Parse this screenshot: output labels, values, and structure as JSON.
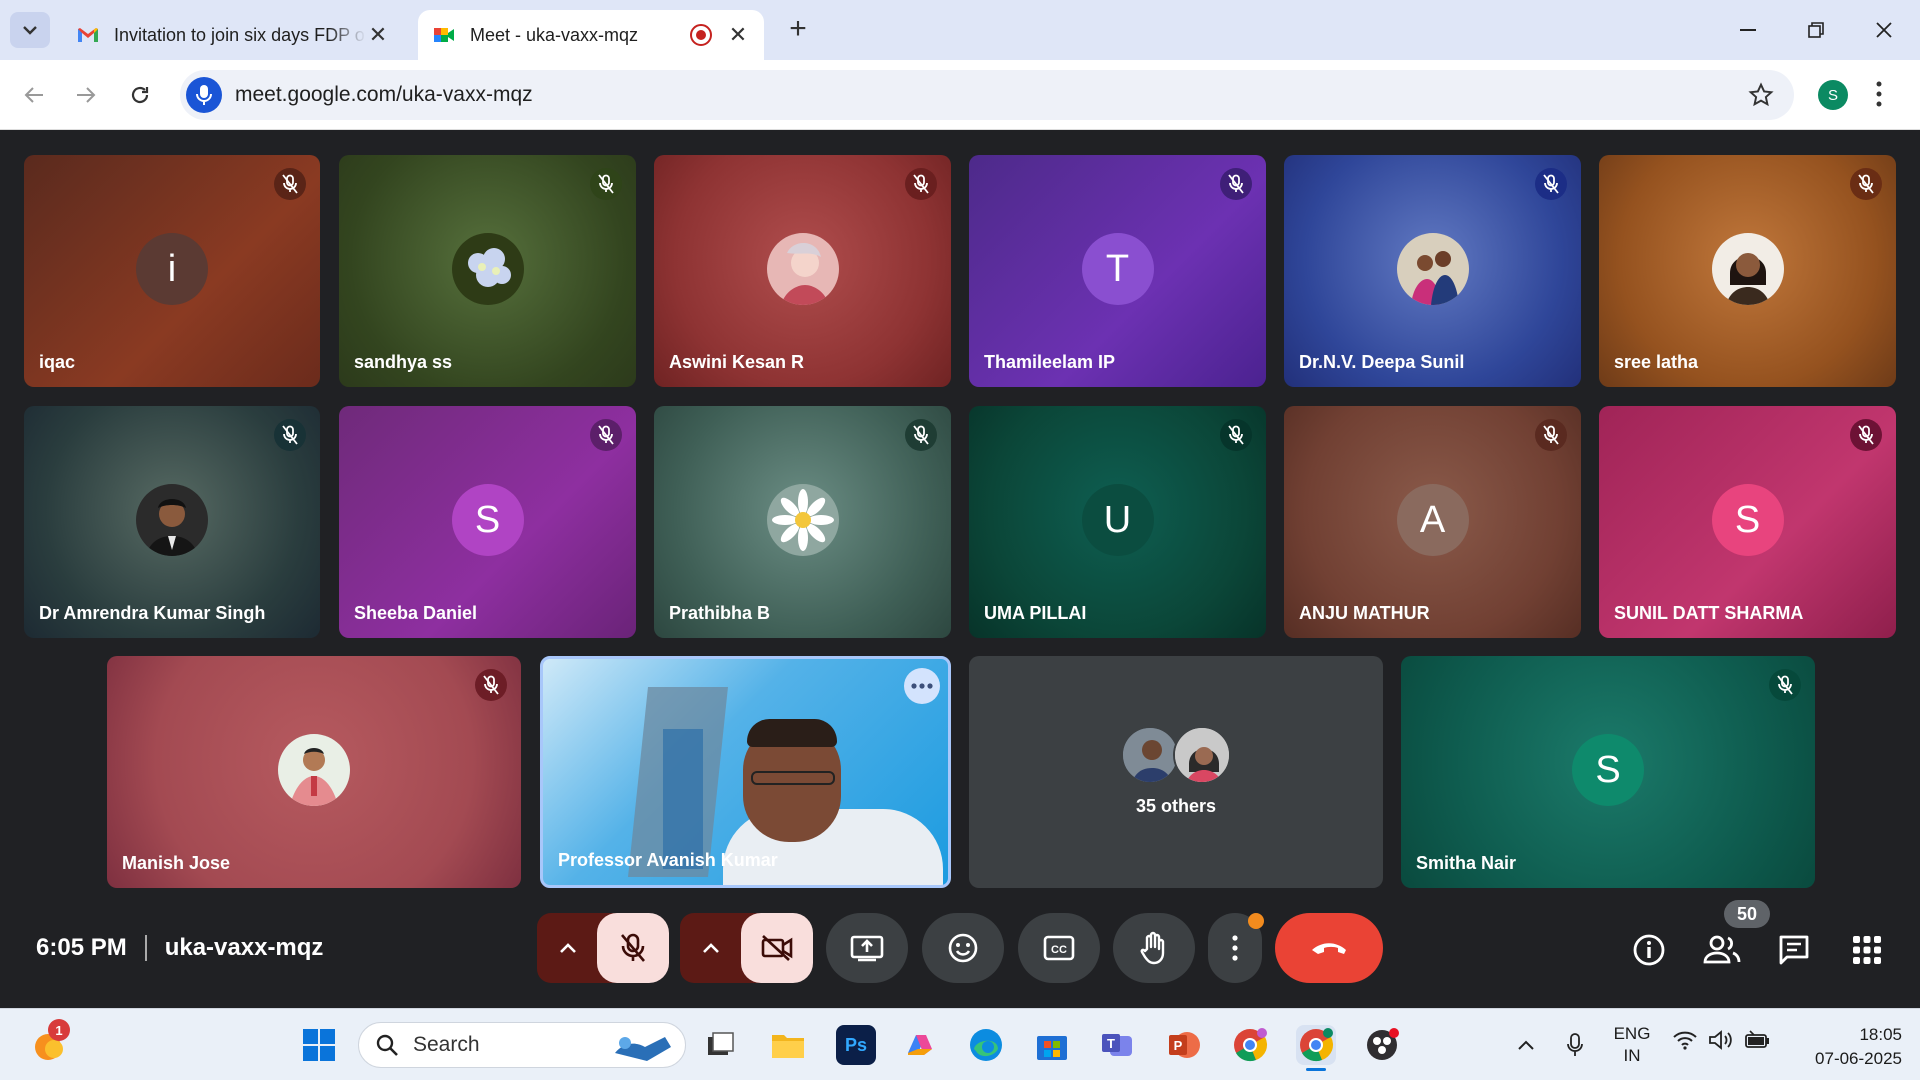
{
  "browser": {
    "tabs": [
      {
        "title": "Invitation to join six days FDP o",
        "icon": "gmail-icon"
      },
      {
        "title": "Meet - uka-vaxx-mqz",
        "icon": "meet-icon",
        "active": true,
        "recording": true
      }
    ],
    "url": "meet.google.com/uka-vaxx-mqz",
    "profile_initial": "S"
  },
  "participants": [
    {
      "name": "iqac",
      "avatar": "i",
      "avatar_bg": "#5b3a33"
    },
    {
      "name": "sandhya ss",
      "avatar": "photo-hydrangea"
    },
    {
      "name": "Aswini Kesan R",
      "avatar": "photo-portrait"
    },
    {
      "name": "Thamileelam IP",
      "avatar": "T",
      "avatar_bg": "#8a4fd0"
    },
    {
      "name": "Dr.N.V. Deepa Sunil",
      "avatar": "photo-couple"
    },
    {
      "name": "sree latha",
      "avatar": "photo-woman"
    },
    {
      "name": "Dr Amrendra Kumar Singh",
      "avatar": "photo-man"
    },
    {
      "name": "Sheeba Daniel",
      "avatar": "S",
      "avatar_bg": "#b044c4"
    },
    {
      "name": "Prathibha B",
      "avatar": "photo-daisy"
    },
    {
      "name": "UMA PILLAI",
      "avatar": "U",
      "avatar_bg": "#0b4d40"
    },
    {
      "name": "ANJU MATHUR",
      "avatar": "A",
      "avatar_bg": "#8a6a5e"
    },
    {
      "name": "SUNIL DATT SHARMA",
      "avatar": "S",
      "avatar_bg": "#e8447e"
    },
    {
      "name": "Manish Jose",
      "avatar": "photo-man-2"
    },
    {
      "name": "Professor Avanish Kumar",
      "avatar": "video"
    },
    {
      "name": "35 others",
      "avatar": "group"
    },
    {
      "name": "Smitha Nair",
      "avatar": "S",
      "avatar_bg": "#0e8a6c"
    }
  ],
  "meeting": {
    "time": "6:05 PM",
    "code": "uka-vaxx-mqz",
    "participant_count": "50"
  },
  "taskbar": {
    "search_placeholder": "Search",
    "notification_count": "1",
    "lang_line1": "ENG",
    "lang_line2": "IN",
    "clock_time": "18:05",
    "clock_date": "07-06-2025",
    "ps_label": "Ps"
  }
}
